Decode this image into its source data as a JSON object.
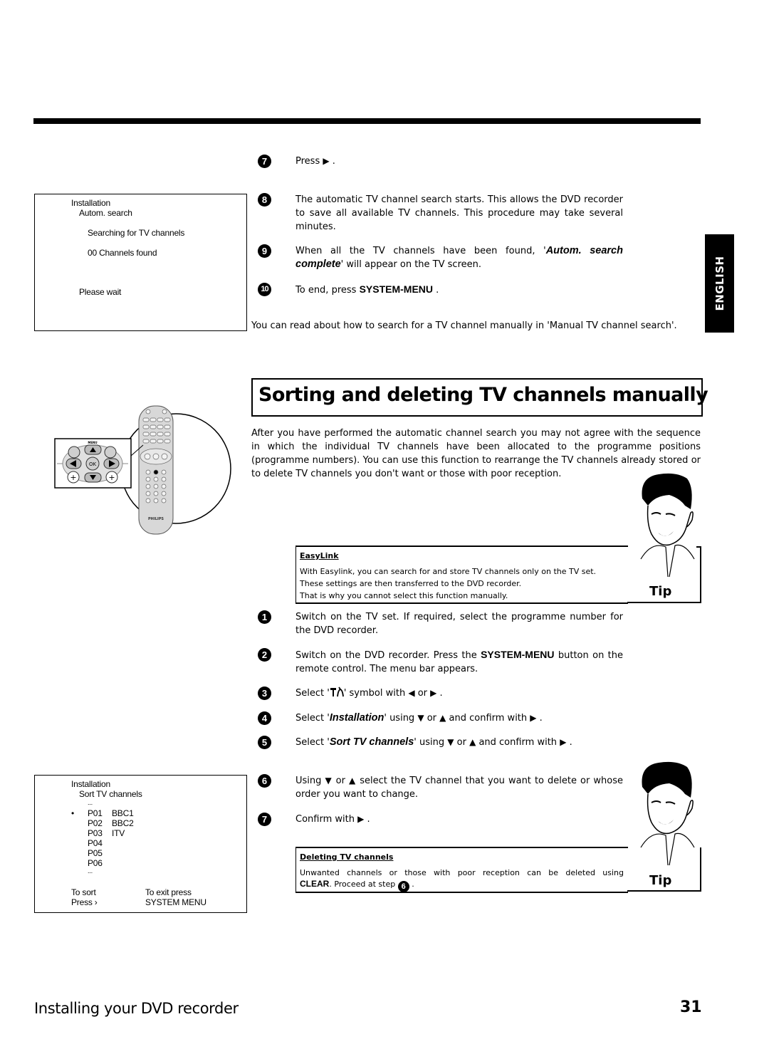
{
  "osd_autom_search": {
    "title": "Installation",
    "subtitle": "Autom. search",
    "line1": "Searching for TV channels",
    "line2": "00 Channels found",
    "line3": "Please wait"
  },
  "steps_top": [
    {
      "num": "7",
      "text_before": "Press",
      "arrow": "▶",
      "text_after": "."
    },
    {
      "num": "8",
      "text": "The automatic TV channel search starts. This allows the DVD recorder to save all available TV channels. This procedure may take several minutes."
    },
    {
      "num": "9",
      "text_before": "When all the TV channels have been found, '",
      "emph": "Autom. search complete",
      "text_after": "' will appear on the TV screen."
    },
    {
      "num": "10",
      "text_before": "To end, press",
      "key": "SYSTEM-MENU",
      "text_after": "."
    }
  ],
  "manual_search_note": "You can read about how to search for a TV channel manually in 'Manual TV channel search'.",
  "language_tab": "ENGLISH",
  "section": {
    "heading": "Sorting and deleting TV channels manually",
    "intro": "After you have performed the automatic channel search you may not agree with the sequence in which the individual TV channels have been allocated to the programme positions (programme numbers). You can use this function to rearrange the TV channels already stored or to delete TV channels you don't want or those with poor reception."
  },
  "remote": {
    "brand": "PHILIPS",
    "detail_labels": {
      "menu": "MENU",
      "ok": "OK"
    }
  },
  "tip_easylink": {
    "title": "EasyLink",
    "lines": [
      "With Easylink, you can search for and store TV channels only on the TV set.",
      "These settings are then transferred to the DVD recorder.",
      "That is why you cannot select this function manually."
    ],
    "label": "Tip"
  },
  "steps_sort": [
    {
      "num": "1",
      "text": "Switch on the TV set. If required, select the programme number for the DVD recorder."
    },
    {
      "num": "2",
      "text_before": "Switch on the DVD recorder. Press the",
      "key": "SYSTEM-MENU",
      "text_after": "button on the remote control. The menu bar appears."
    },
    {
      "num": "3",
      "text_before": "Select '",
      "symbol": "installation-symbol",
      "text_mid": "' symbol with",
      "arrow1": "◀",
      "or": "or",
      "arrow2": "▶",
      "text_after": "."
    },
    {
      "num": "4",
      "text_before": "Select '",
      "emph": "Installation",
      "text_mid": "' using",
      "arrow1": "▼",
      "or": "or",
      "arrow2": "▲",
      "confirm": "and confirm with",
      "arrow3": "▶",
      "text_after": "."
    },
    {
      "num": "5",
      "text_before": "Select '",
      "emph": "Sort TV channels",
      "text_mid": "' using",
      "arrow1": "▼",
      "or": "or",
      "arrow2": "▲",
      "confirm": "and confirm with",
      "arrow3": "▶",
      "text_after": "."
    },
    {
      "num": "6",
      "text_before": "Using",
      "arrow1": "▼",
      "or": "or",
      "arrow2": "▲",
      "text_after": "select the TV channel that you want to delete or whose order you want to change."
    },
    {
      "num": "7",
      "text_before": "Confirm with",
      "arrow": "▶",
      "text_after": "."
    }
  ],
  "tip_delete": {
    "title": "Deleting TV channels",
    "line1": "Unwanted channels or those with poor reception can be deleted using",
    "key": "CLEAR",
    "line2_mid": ". Proceed at step",
    "step_ref": "6",
    "line2_end": ".",
    "label": "Tip"
  },
  "osd_sort": {
    "title": "Installation",
    "subtitle": "Sort TV channels",
    "ellipsis_top": "...",
    "selected_marker": "•",
    "channels": [
      {
        "pos": "P01",
        "name": "BBC1",
        "selected": true
      },
      {
        "pos": "P02",
        "name": "BBC2"
      },
      {
        "pos": "P03",
        "name": "ITV"
      },
      {
        "pos": "P04",
        "name": ""
      },
      {
        "pos": "P05",
        "name": ""
      },
      {
        "pos": "P06",
        "name": ""
      }
    ],
    "ellipsis_bottom": "...",
    "sort_hint_1": "To sort",
    "sort_hint_2": "Press ›",
    "exit_hint_1": "To exit press",
    "exit_hint_2": "SYSTEM MENU"
  },
  "footer": {
    "section_title": "Installing your DVD recorder",
    "page_number": "31"
  }
}
